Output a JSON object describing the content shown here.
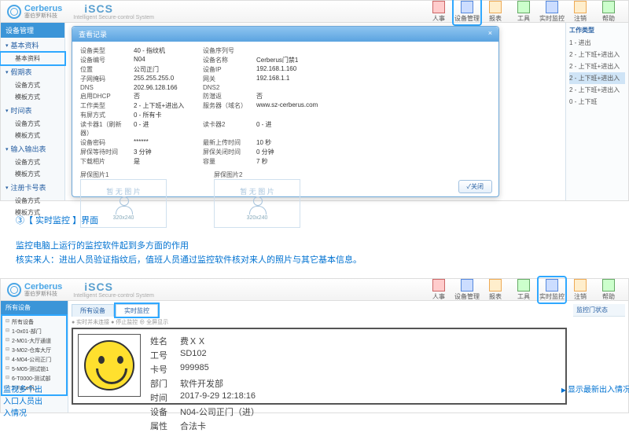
{
  "brand": {
    "name": "Cerberus",
    "sub": "塞伯罗斯科技",
    "iscs": "iSCS",
    "iscs_sub": "Intelligent Secure-control System"
  },
  "nav": [
    {
      "label": "人事"
    },
    {
      "label": "设备管理"
    },
    {
      "label": "报表"
    },
    {
      "label": "工具"
    },
    {
      "label": "实时监控"
    },
    {
      "label": "注销"
    },
    {
      "label": "帮助"
    }
  ],
  "side_title": "设备管理",
  "side": [
    {
      "grp": "基本资料",
      "subs": [
        "基本资料"
      ]
    },
    {
      "grp": "假期表",
      "subs": [
        "设备方式",
        "模板方式"
      ]
    },
    {
      "grp": "时间表",
      "subs": [
        "设备方式",
        "模板方式"
      ]
    },
    {
      "grp": "输入输出表",
      "subs": [
        "设备方式",
        "模板方式"
      ]
    },
    {
      "grp": "注册卡号表",
      "subs": [
        "设备方式",
        "模板方式"
      ]
    }
  ],
  "rside_title": "工作类型",
  "rside": [
    "1 - 进出",
    "2 - 上下班+进出入",
    "2 - 上下班+进出入",
    "2 - 上下班+进出入",
    "2 - 上下班+进出入",
    "0 - 上下班"
  ],
  "rside_sel": 3,
  "modal": {
    "title": "查看记录",
    "close": "×",
    "rows": [
      [
        "设备类型",
        "40 - 指纹机",
        "设备序列号",
        ""
      ],
      [
        "设备编号",
        "N04",
        "设备名称",
        "Cerberus门禁1"
      ],
      [
        "位置",
        "公司正门",
        "设备IP",
        "192.168.1.160"
      ],
      [
        "子网掩码",
        "255.255.255.0",
        "网关",
        "192.168.1.1"
      ],
      [
        "DNS",
        "202.96.128.166",
        "DNS2",
        ""
      ],
      [
        "启用DHCP",
        "否",
        "防潜返",
        "否"
      ],
      [
        "工作类型",
        "2 - 上下班+进出入",
        "服务器（域名）",
        "www.sz-cerberus.com"
      ],
      [
        "有屏方式",
        "0 - 所有卡",
        "",
        ""
      ],
      [
        "读卡器1（刷新器）",
        "0 - 进",
        "读卡器2",
        "0 - 进"
      ],
      [
        "设备密码",
        "******",
        "最新上传时间",
        "10 秒"
      ],
      [
        "屏保等待时间",
        "3 分钟",
        "屏保关闭时间",
        "0 分钟"
      ],
      [
        "下载相片",
        "是",
        "容量",
        "7 秒"
      ]
    ],
    "img_lbl1": "屏保图片1",
    "img_lbl2": "屏保图片2",
    "no_image": "暂 无 图 片",
    "dim": "320x240",
    "btn_close": "✓关闭"
  },
  "caption": {
    "line1": "③【 实时监控 】界面",
    "line2": "监控电脑上运行的监控软件起到多方面的作用",
    "line3": "核实来人：进出人员验证指纹后，值班人员通过监控软件核对来人的照片与其它基本信息。"
  },
  "app2": {
    "side_title": "所有设备",
    "tree": [
      "所有设备",
      "1-0x01-部门",
      "2-M01-大厅通道",
      "3-M02-仓库大厅",
      "4-M04-公司正门",
      "5-M05-测试锁1",
      "6-T0000-测试部",
      "T-Face机1"
    ],
    "tabs": [
      "所有设备",
      "实时监控"
    ],
    "crumb": "● 实时并未连接 ● 停止监控 ⊕ 全屏显示",
    "rpanel": "监控门状态",
    "info": [
      [
        "姓名",
        "费ＸＸ"
      ],
      [
        "工号",
        "SD102"
      ],
      [
        "卡号",
        "999985"
      ],
      [
        "部门",
        "软件开发部"
      ],
      [
        "时间",
        "2017-9-29 12:18:16"
      ],
      [
        "设备",
        "N04-公司正门（进）"
      ],
      [
        "属性",
        "合法卡"
      ]
    ]
  },
  "anno": {
    "left": "监视多个出\n入口人员出\n入情况",
    "right": "显示最新出入情况"
  }
}
